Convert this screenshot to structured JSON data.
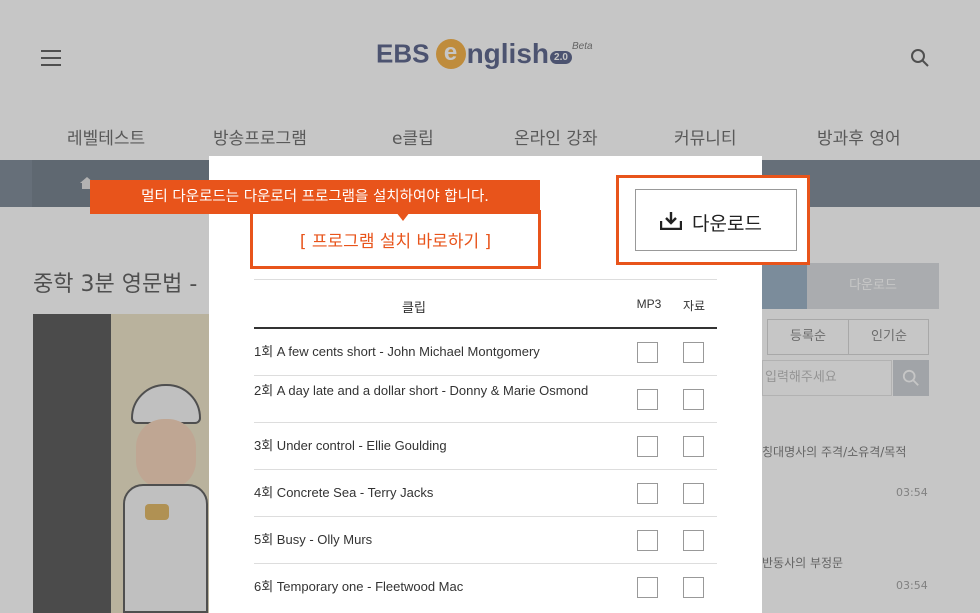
{
  "header": {
    "logo_ebs": "EBS",
    "logo_e": "e",
    "logo_nglish": "nglish",
    "logo_version": "2.0",
    "logo_beta": "Beta",
    "menu_icon": "hamburger-icon",
    "search_icon": "search-icon"
  },
  "nav": {
    "items": [
      "레벨테스트",
      "방송프로그램",
      "e클립",
      "온라인 강좌",
      "커뮤니티",
      "방과후 영어"
    ]
  },
  "page": {
    "title": "중학 3분 영문법 -"
  },
  "sidebar": {
    "download_tab": "다운로드",
    "sort": [
      "등록순",
      "인기순"
    ],
    "search_placeholder": "입력해주세요",
    "items": [
      {
        "title": "칭대명사의 주격/소유격/목적",
        "time": "03:54"
      },
      {
        "title": "반동사의 부정문",
        "time": "03:54"
      }
    ]
  },
  "tooltip": {
    "message": "멀티 다운로드는 다운로더 프로그램을 설치하여야 합니다.",
    "install_link": "[ 프로그램 설치 바로하기 ]"
  },
  "download_button": {
    "label": "다운로드",
    "icon": "download-icon"
  },
  "modal": {
    "columns": {
      "clip": "클립",
      "mp3": "MP3",
      "data": "자료"
    },
    "rows": [
      {
        "title": "1회 A few cents short - John Michael Montgomery"
      },
      {
        "title": "2회 A day late and a dollar short - Donny & Marie Osmond"
      },
      {
        "title": "3회 Under control - Ellie Goulding"
      },
      {
        "title": "4회 Concrete Sea - Terry Jacks"
      },
      {
        "title": "5회 Busy - Olly Murs"
      },
      {
        "title": "6회 Temporary one - Fleetwood Mac"
      }
    ]
  },
  "colors": {
    "accent": "#e8541b",
    "brand_navy": "#2d3a6b",
    "brand_orange": "#f39c12"
  }
}
